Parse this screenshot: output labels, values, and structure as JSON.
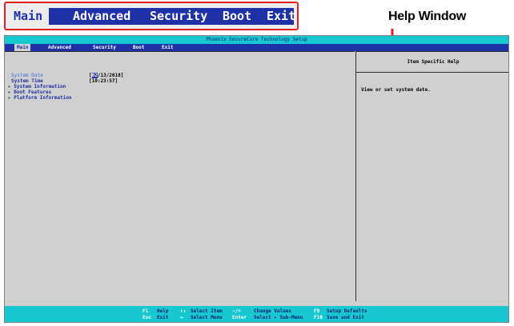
{
  "callout": {
    "menu": [
      "Main",
      "Advanced",
      "Security",
      "Boot",
      "Exit"
    ]
  },
  "annotation": {
    "help_window_label": "Help Window"
  },
  "bios": {
    "title": "Phoenix SecureCore Technology Setup",
    "menu": [
      "Main",
      "Advanced",
      "Security",
      "Boot",
      "Exit"
    ],
    "rows": [
      {
        "label": "System Date",
        "value_cursor": "02",
        "value_rest": "/13/2018]",
        "value_open": "["
      },
      {
        "label": "System Time",
        "value": "[10:23:57]"
      },
      {
        "label": "▸ System Information"
      },
      {
        "label": "▸ Boot Features"
      },
      {
        "label": "▸ Platform Information"
      }
    ],
    "help_header": "Item Specific Help",
    "help_text": "View or set system date.",
    "status": [
      {
        "key": "F1",
        "desc": "Help"
      },
      {
        "key": "↑↓",
        "desc": "Select Item"
      },
      {
        "key": "-/+",
        "desc": "Change Values"
      },
      {
        "key": "F9",
        "desc": "Setup Defaults"
      },
      {
        "key": "Esc",
        "desc": "Exit"
      },
      {
        "key": "↔",
        "desc": "Select Menu"
      },
      {
        "key": "Enter",
        "desc": "Select ▸ Sub-Menu"
      },
      {
        "key": "F10",
        "desc": "Save and Exit"
      }
    ]
  },
  "colors": {
    "bios_blue": "#1f31a6",
    "cyan": "#18c8d0",
    "gray": "#d0d0d0",
    "callout_red": "#e02020"
  }
}
